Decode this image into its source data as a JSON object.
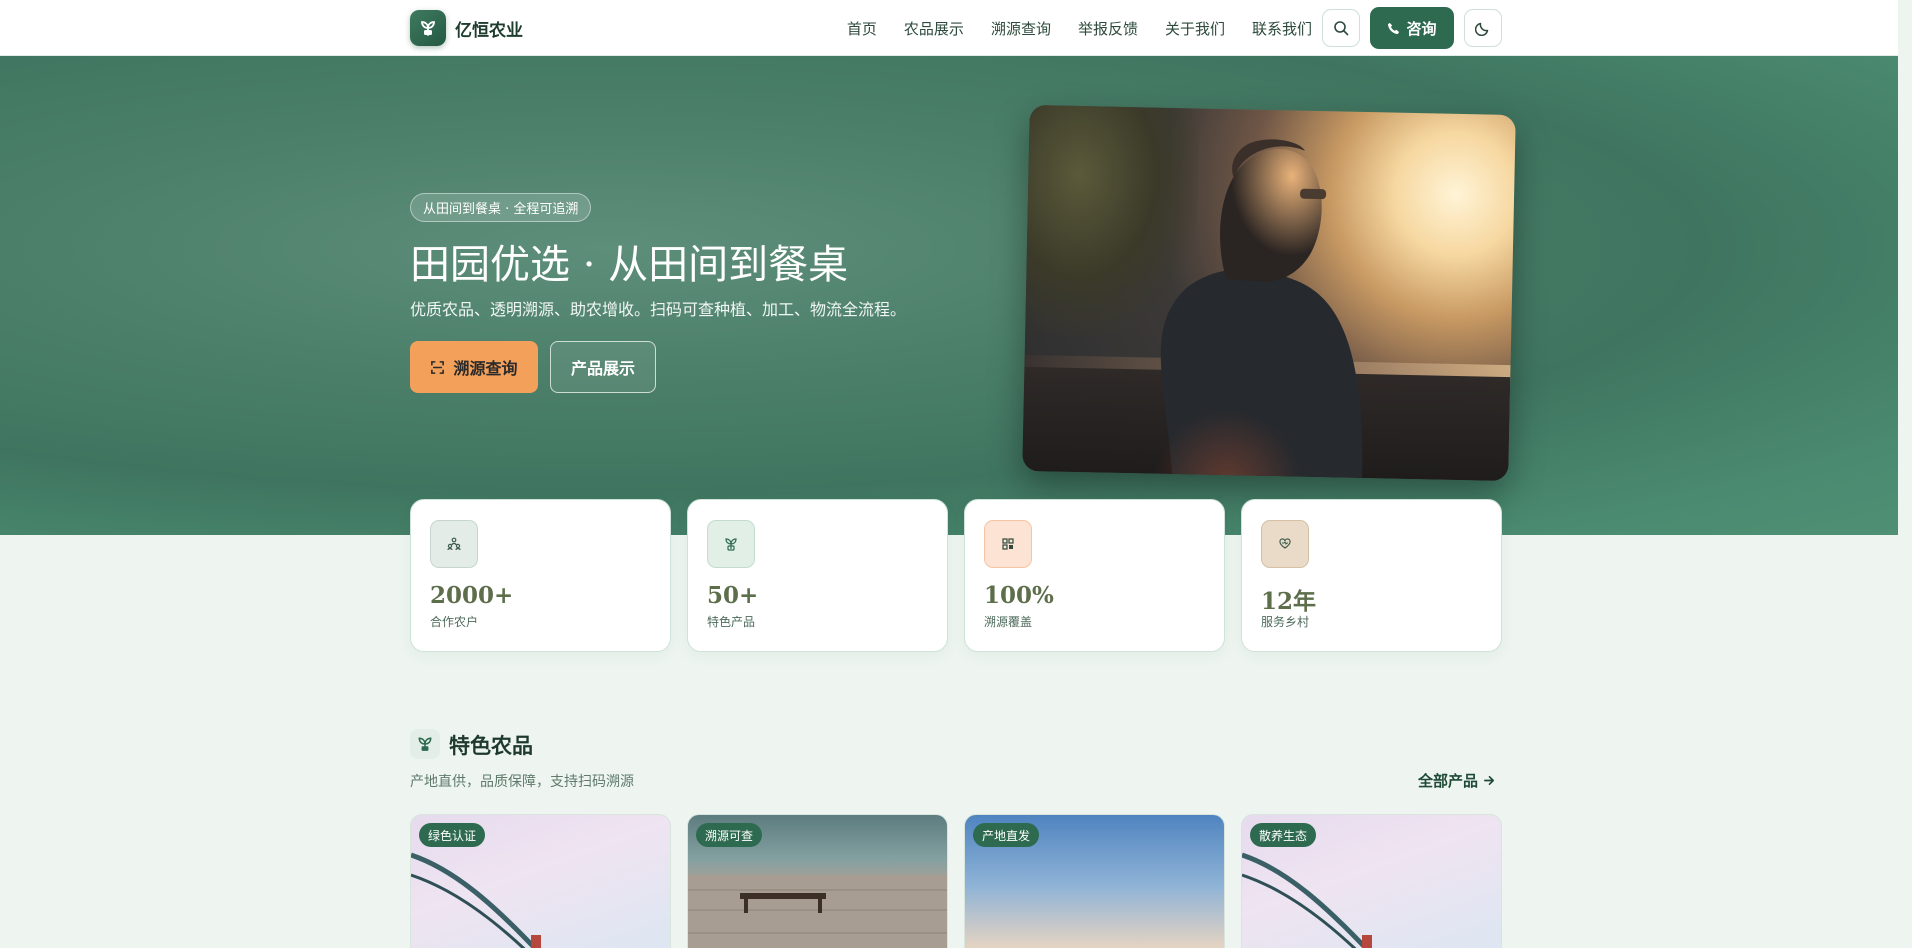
{
  "brand": {
    "name": "亿恒农业"
  },
  "nav": {
    "items": [
      "首页",
      "农品展示",
      "溯源查询",
      "举报反馈",
      "关于我们",
      "联系我们"
    ],
    "consult_label": "咨询"
  },
  "hero": {
    "pill": "从田间到餐桌 · 全程可追溯",
    "title": "田园优选 · 从田间到餐桌",
    "subtitle": "优质农品、透明溯源、助农增收。扫码可查种植、加工、物流全流程。",
    "primary_button": "溯源查询",
    "secondary_button": "产品展示"
  },
  "stats": [
    {
      "value": "2000+",
      "label": "合作农户",
      "icon": "farmers-icon",
      "accent": "#e4ece8"
    },
    {
      "value": "50+",
      "label": "特色产品",
      "icon": "sprout-icon",
      "accent": "#e1efe7"
    },
    {
      "value": "100%",
      "label": "溯源覆盖",
      "icon": "qr-code-icon",
      "accent": "#fde3d3"
    },
    {
      "value": "12年",
      "label": "服务乡村",
      "icon": "heart-hands-icon",
      "accent": "#eadbc9"
    }
  ],
  "featured": {
    "title": "特色农品",
    "subtitle": "产地直供，品质保障，支持扫码溯源",
    "more_link": "全部产品"
  },
  "products": [
    {
      "tag": "绿色认证"
    },
    {
      "tag": "溯源可查"
    },
    {
      "tag": "产地直发"
    },
    {
      "tag": "散养生态"
    }
  ],
  "colors": {
    "primary": "#2d6a4f",
    "accent": "#f2a05a",
    "hero": "#4a7e68",
    "background": "#eef5f1"
  }
}
